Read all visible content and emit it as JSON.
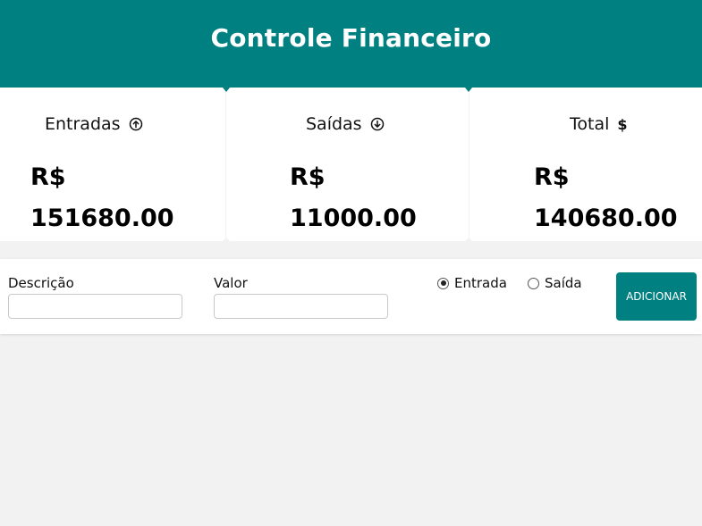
{
  "header": {
    "title": "Controle Financeiro",
    "background_color": "#008080"
  },
  "summary": {
    "entradas": {
      "label": "Entradas",
      "icon": "arrow-up-circle-icon",
      "currency": "R$",
      "amount": "151680.00"
    },
    "saidas": {
      "label": "Saídas",
      "icon": "arrow-down-circle-icon",
      "currency": "R$",
      "amount": "11000.00"
    },
    "total": {
      "label": "Total",
      "icon": "dollar-icon",
      "icon_glyph": "$",
      "currency": "R$",
      "amount": "140680.00"
    }
  },
  "form": {
    "descricao": {
      "label": "Descrição",
      "value": ""
    },
    "valor": {
      "label": "Valor",
      "value": ""
    },
    "type_options": [
      {
        "label": "Entrada",
        "checked": true
      },
      {
        "label": "Saída",
        "checked": false
      }
    ],
    "add_button_label": "ADICIONAR",
    "accent_color": "#008080"
  }
}
